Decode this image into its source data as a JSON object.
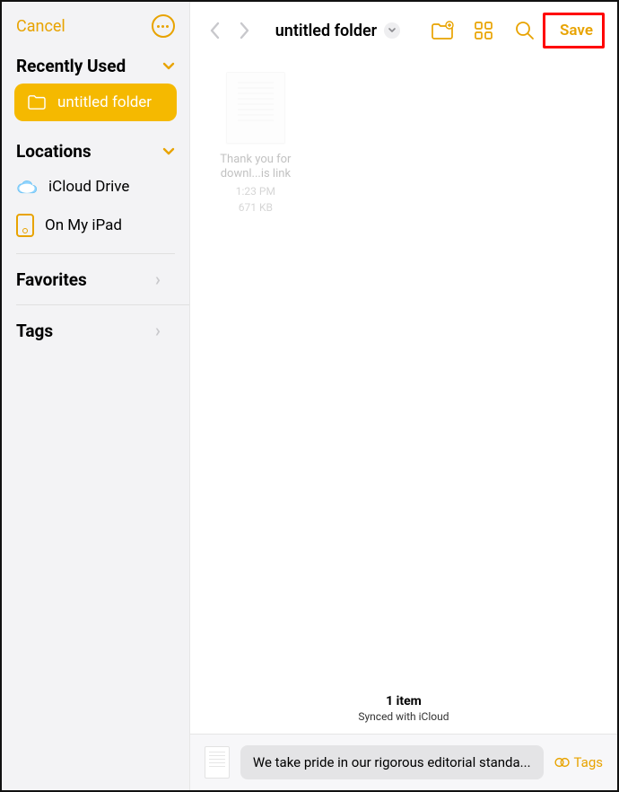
{
  "sidebar": {
    "cancel": "Cancel",
    "recently_used": "Recently Used",
    "current_folder": "untitled folder",
    "locations_header": "Locations",
    "locations": [
      {
        "label": "iCloud Drive"
      },
      {
        "label": "On My iPad"
      }
    ],
    "favorites": "Favorites",
    "tags": "Tags"
  },
  "toolbar": {
    "title": "untitled folder",
    "save": "Save"
  },
  "files": [
    {
      "name_line1": "Thank you for",
      "name_line2": "downl...is link",
      "time": "1:23 PM",
      "size": "671 KB"
    }
  ],
  "footer": {
    "count": "1 item",
    "sync": "Synced with iCloud"
  },
  "bottom": {
    "filename": "We take pride in our rigorous editorial standa...",
    "tags_label": "Tags"
  }
}
